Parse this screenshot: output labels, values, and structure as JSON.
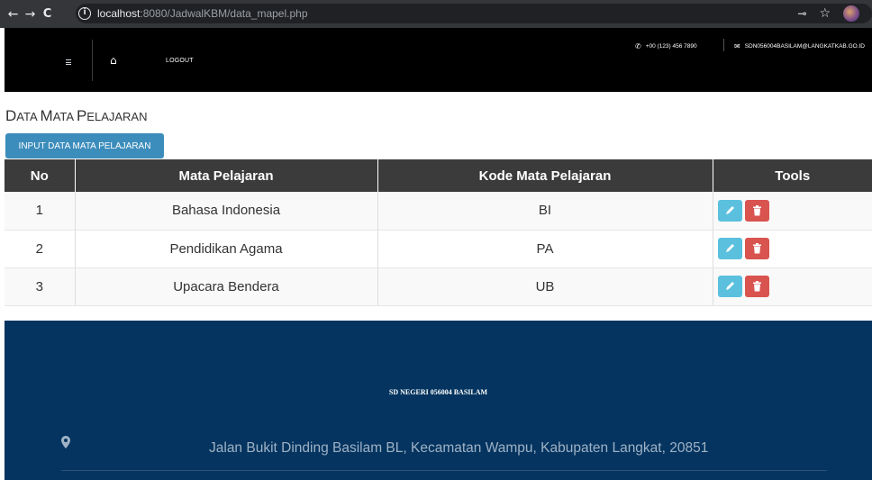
{
  "browser": {
    "url_host": "localhost",
    "url_rest": ":8080/JadwalKBM/data_mapel.php",
    "back_icon": "←",
    "forward_icon": "→",
    "reload_icon": "C",
    "info_icon": "i",
    "key_icon": "⊸",
    "star_icon": "☆"
  },
  "header": {
    "logout_label": "LOGOUT",
    "phone": "+00 (123) 456 7890",
    "email": "SDN056004BASILAM@LANGKATKAB.GO.ID",
    "home_icon": "⌂",
    "phone_icon": "✆",
    "mail_icon": "✉"
  },
  "page": {
    "title_first": "D",
    "title_rest": "ATA ",
    "title_m": "M",
    "title_m_rest": "ATA ",
    "title_p": "P",
    "title_p_rest": "ELAJARAN",
    "input_button": "INPUT DATA MATA PELAJARAN"
  },
  "table": {
    "headers": [
      "No",
      "Mata Pelajaran",
      "Kode Mata Pelajaran",
      "Tools"
    ],
    "rows": [
      {
        "no": "1",
        "mapel": "Bahasa Indonesia",
        "kode": "BI"
      },
      {
        "no": "2",
        "mapel": "Pendidikan Agama",
        "kode": "PA"
      },
      {
        "no": "3",
        "mapel": "Upacara Bendera",
        "kode": "UB"
      }
    ]
  },
  "footer": {
    "school_name": "SD NEGERI 056004 BASILAM",
    "address": "Jalan Bukit Dinding Basilam BL, Kecamatan Wampu, Kabupaten Langkat, 20851"
  },
  "colors": {
    "header_bg": "#000000",
    "table_header_bg": "#3b3b3b",
    "primary_button": "#3c8dbc",
    "edit_button": "#5bc0de",
    "delete_button": "#d9534f",
    "footer_bg": "#04345f"
  }
}
